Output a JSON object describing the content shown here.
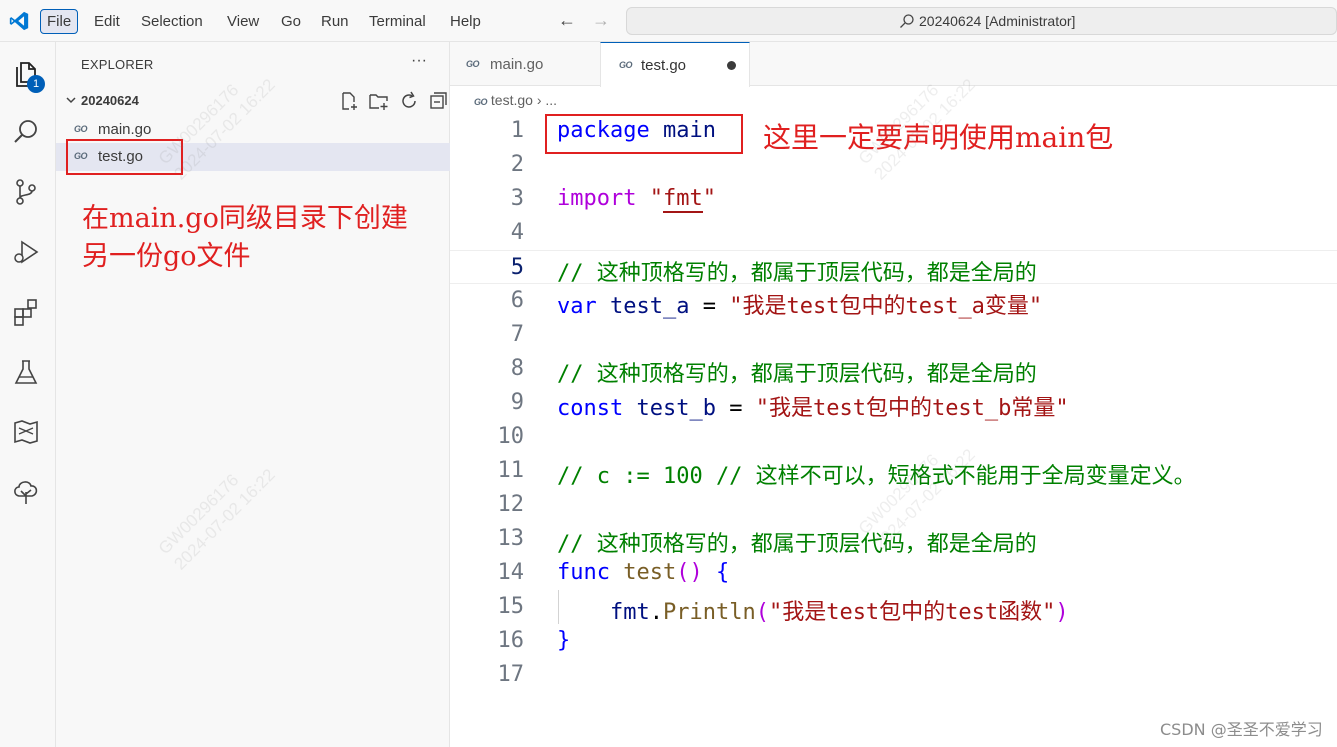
{
  "menu": {
    "items": [
      "File",
      "Edit",
      "Selection",
      "View",
      "Go",
      "Run",
      "Terminal",
      "Help"
    ],
    "active": "File"
  },
  "command_center": {
    "text": "20240624 [Administrator]"
  },
  "activity_bar": {
    "explorer_badge": "1"
  },
  "sidebar": {
    "title": "EXPLORER",
    "more": "···",
    "folder": "20240624",
    "files": [
      {
        "badge": "GO",
        "name": "main.go"
      },
      {
        "badge": "GO",
        "name": "test.go"
      }
    ],
    "annotation_line1": "在main.go同级目录下创建",
    "annotation_line2": "另一份go文件"
  },
  "editor": {
    "tabs": [
      {
        "badge": "GO",
        "label": "main.go"
      },
      {
        "badge": "GO",
        "label": "test.go"
      }
    ],
    "breadcrumb_file": "test.go",
    "breadcrumb_sep": "›",
    "breadcrumb_more": "...",
    "annotation": "这里一定要声明使用main包",
    "lines": [
      {
        "n": "1"
      },
      {
        "n": "2"
      },
      {
        "n": "3"
      },
      {
        "n": "4"
      },
      {
        "n": "5"
      },
      {
        "n": "6"
      },
      {
        "n": "7"
      },
      {
        "n": "8"
      },
      {
        "n": "9"
      },
      {
        "n": "10"
      },
      {
        "n": "11"
      },
      {
        "n": "12"
      },
      {
        "n": "13"
      },
      {
        "n": "14"
      },
      {
        "n": "15"
      },
      {
        "n": "16"
      },
      {
        "n": "17"
      }
    ],
    "code": {
      "l1_kw": "package",
      "l1_name": "main",
      "l3_kw": "import",
      "l3_q1": "\"",
      "l3_str": "fmt",
      "l3_q2": "\"",
      "l5": "// 这种顶格写的，都属于顶层代码，都是全局的",
      "l6_kw": "var",
      "l6_name": "test_a",
      "l6_eq": " = ",
      "l6_str": "\"我是test包中的test_a变量\"",
      "l8": "// 这种顶格写的，都属于顶层代码，都是全局的",
      "l9_kw": "const",
      "l9_name": "test_b",
      "l9_eq": " = ",
      "l9_str": "\"我是test包中的test_b常量\"",
      "l11": "// c := 100 // 这样不可以，短格式不能用于全局变量定义。",
      "l13": "// 这种顶格写的，都属于顶层代码，都是全局的",
      "l14_kw": "func",
      "l14_name": "test",
      "l14_paren": "()",
      "l14_brace": "{",
      "l15_pkg": "fmt",
      "l15_dot": ".",
      "l15_fn": "Println",
      "l15_open": "(",
      "l15_str": "\"我是test包中的test函数\"",
      "l15_close": ")",
      "l16_brace": "}"
    }
  },
  "watermark": {
    "line1": "GW00296176",
    "line2": "2024-07-02 16:22"
  },
  "footer_mark": "CSDN @圣圣不爱学习",
  "colors": {
    "accent": "#005fb8",
    "annotation": "#e02020"
  }
}
